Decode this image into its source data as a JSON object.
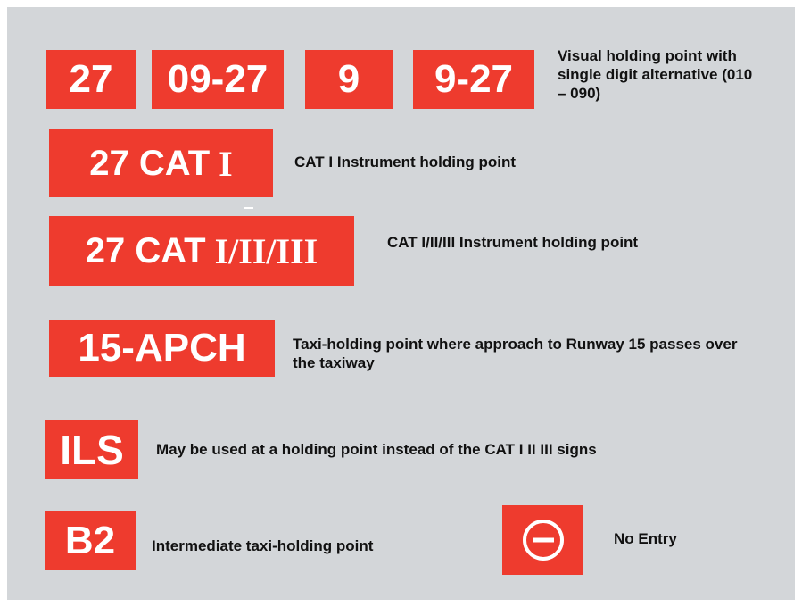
{
  "colors": {
    "background": "#d3d6d9",
    "sign_red": "#ee3b2e",
    "sign_text": "#ffffff",
    "text": "#111111"
  },
  "row1": {
    "signs": [
      "27",
      "09-27",
      "9",
      "9-27"
    ],
    "description": "Visual holding point with single digit alternative (010 – 090)"
  },
  "row2": {
    "sign_main": "27 CAT",
    "sign_roman": "I",
    "description": "CAT I Instrument  holding point"
  },
  "row3": {
    "sign_main": "27 CAT",
    "sign_roman": "I/II/III",
    "description": "CAT I/II/III Instrument  holding point"
  },
  "row4": {
    "sign": "15-APCH",
    "description": "Taxi-holding point where approach to Runway 15 passes over the taxiway"
  },
  "row5": {
    "sign": "ILS",
    "description": "May be used at a holding point instead of the CAT I II III signs"
  },
  "row6": {
    "sign": "B2",
    "description": "Intermediate taxi-holding point",
    "no_entry_icon": "no-entry-icon",
    "no_entry_description": "No Entry"
  }
}
